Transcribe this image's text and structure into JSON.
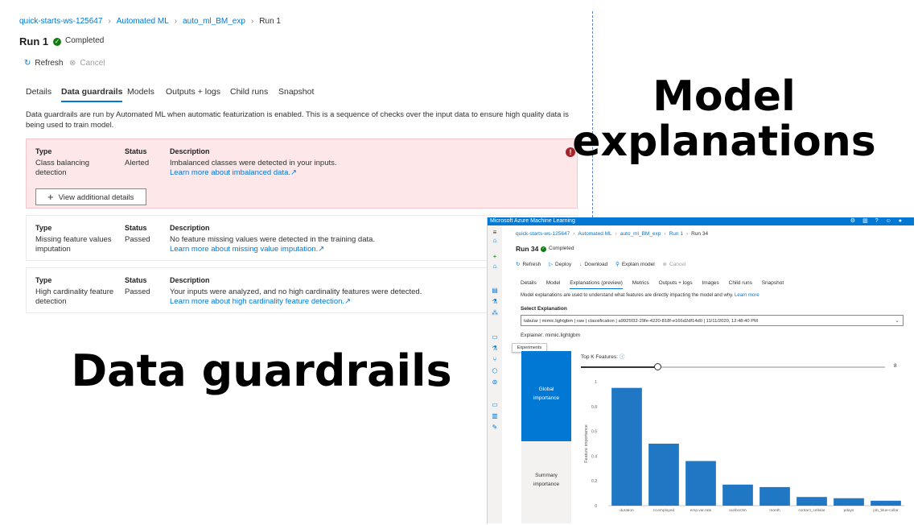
{
  "headlines": {
    "model_explanations_1": "Model",
    "model_explanations_2": "explanations",
    "data_guardrails": "Data guardrails"
  },
  "guardrails_screen": {
    "breadcrumb": [
      "quick-starts-ws-125647",
      "Automated ML",
      "auto_ml_BM_exp",
      "Run 1"
    ],
    "run_title": "Run 1",
    "status": "Completed",
    "commands": {
      "refresh": "Refresh",
      "cancel": "Cancel"
    },
    "tabs": [
      "Details",
      "Data guardrails",
      "Models",
      "Outputs + logs",
      "Child runs",
      "Snapshot"
    ],
    "active_tab": "Data guardrails",
    "intro": "Data guardrails are run by Automated ML when automatic featurization is enabled. This is a sequence of checks over the input data to ensure high quality data is being used to train model.",
    "column_headers": {
      "type": "Type",
      "status": "Status",
      "description": "Description"
    },
    "checks": [
      {
        "type_line1": "Class balancing",
        "type_line2": "detection",
        "status": "Alerted",
        "description": "Imbalanced classes were detected in your inputs.",
        "link": "Learn more about imbalanced data."
      },
      {
        "type_line1": "Missing feature values",
        "type_line2": "imputation",
        "status": "Passed",
        "description": "No feature missing values were detected in the training data.",
        "link": "Learn more about missing value imputation."
      },
      {
        "type_line1": "High cardinality feature",
        "type_line2": "detection",
        "status": "Passed",
        "description": "Your inputs were analyzed, and no high cardinality features were detected.",
        "link": "Learn more about high cardinality feature detection."
      }
    ],
    "view_details_button": "View additional details",
    "colors": {
      "alert_bg": "#fde7e9",
      "accent": "#0078d4",
      "error": "#a4262c",
      "success": "#107c10"
    }
  },
  "explanations_screen": {
    "app_title": "Microsoft Azure Machine Learning",
    "breadcrumb": [
      "quick-starts-ws-125647",
      "Automated ML",
      "auto_ml_BM_exp",
      "Run 1",
      "Run 34"
    ],
    "run_title": "Run 34",
    "status": "Completed",
    "commands": {
      "refresh": "Refresh",
      "deploy": "Deploy",
      "download": "Download",
      "explain": "Explain model",
      "cancel": "Cancel"
    },
    "tabs": [
      "Details",
      "Model",
      "Explanations (preview)",
      "Metrics",
      "Outputs + logs",
      "Images",
      "Child runs",
      "Snapshot"
    ],
    "active_tab": "Explanations (preview)",
    "intro": "Model explanations are used to understand what features are directly impacting the model and why.",
    "intro_link": "Learn more",
    "select_label": "Select Explanation",
    "select_value": "tabular | mimic.lightgbm | raw | classification | a9925f32-29fe-4220-818f-e166d2df14d0 | 11/11/2020, 12:48:40 PM",
    "explainer_text": "Explainer: mimic.lightgbm",
    "tooltip": "Experiments",
    "importance_tabs": {
      "global_1": "Global",
      "global_2": "importance",
      "summary_1": "Summary",
      "summary_2": "importance"
    },
    "topk_label": "Top K Features:",
    "topk_value": "8",
    "topk_fraction": 0.25
  },
  "chart_data": {
    "type": "bar",
    "categories": [
      "duration",
      "nr.employed",
      "emp.var.rate",
      "euribor3m",
      "month",
      "contact_cellular",
      "pdays",
      "job_blue-collar"
    ],
    "values": [
      0.95,
      0.5,
      0.36,
      0.17,
      0.15,
      0.07,
      0.06,
      0.04
    ],
    "ylabel": "Feature importance",
    "ylim": [
      0,
      1
    ],
    "yticks": [
      0,
      0.2,
      0.4,
      0.6,
      0.8,
      1
    ],
    "grid": false,
    "bar_color": "#2078c4"
  }
}
